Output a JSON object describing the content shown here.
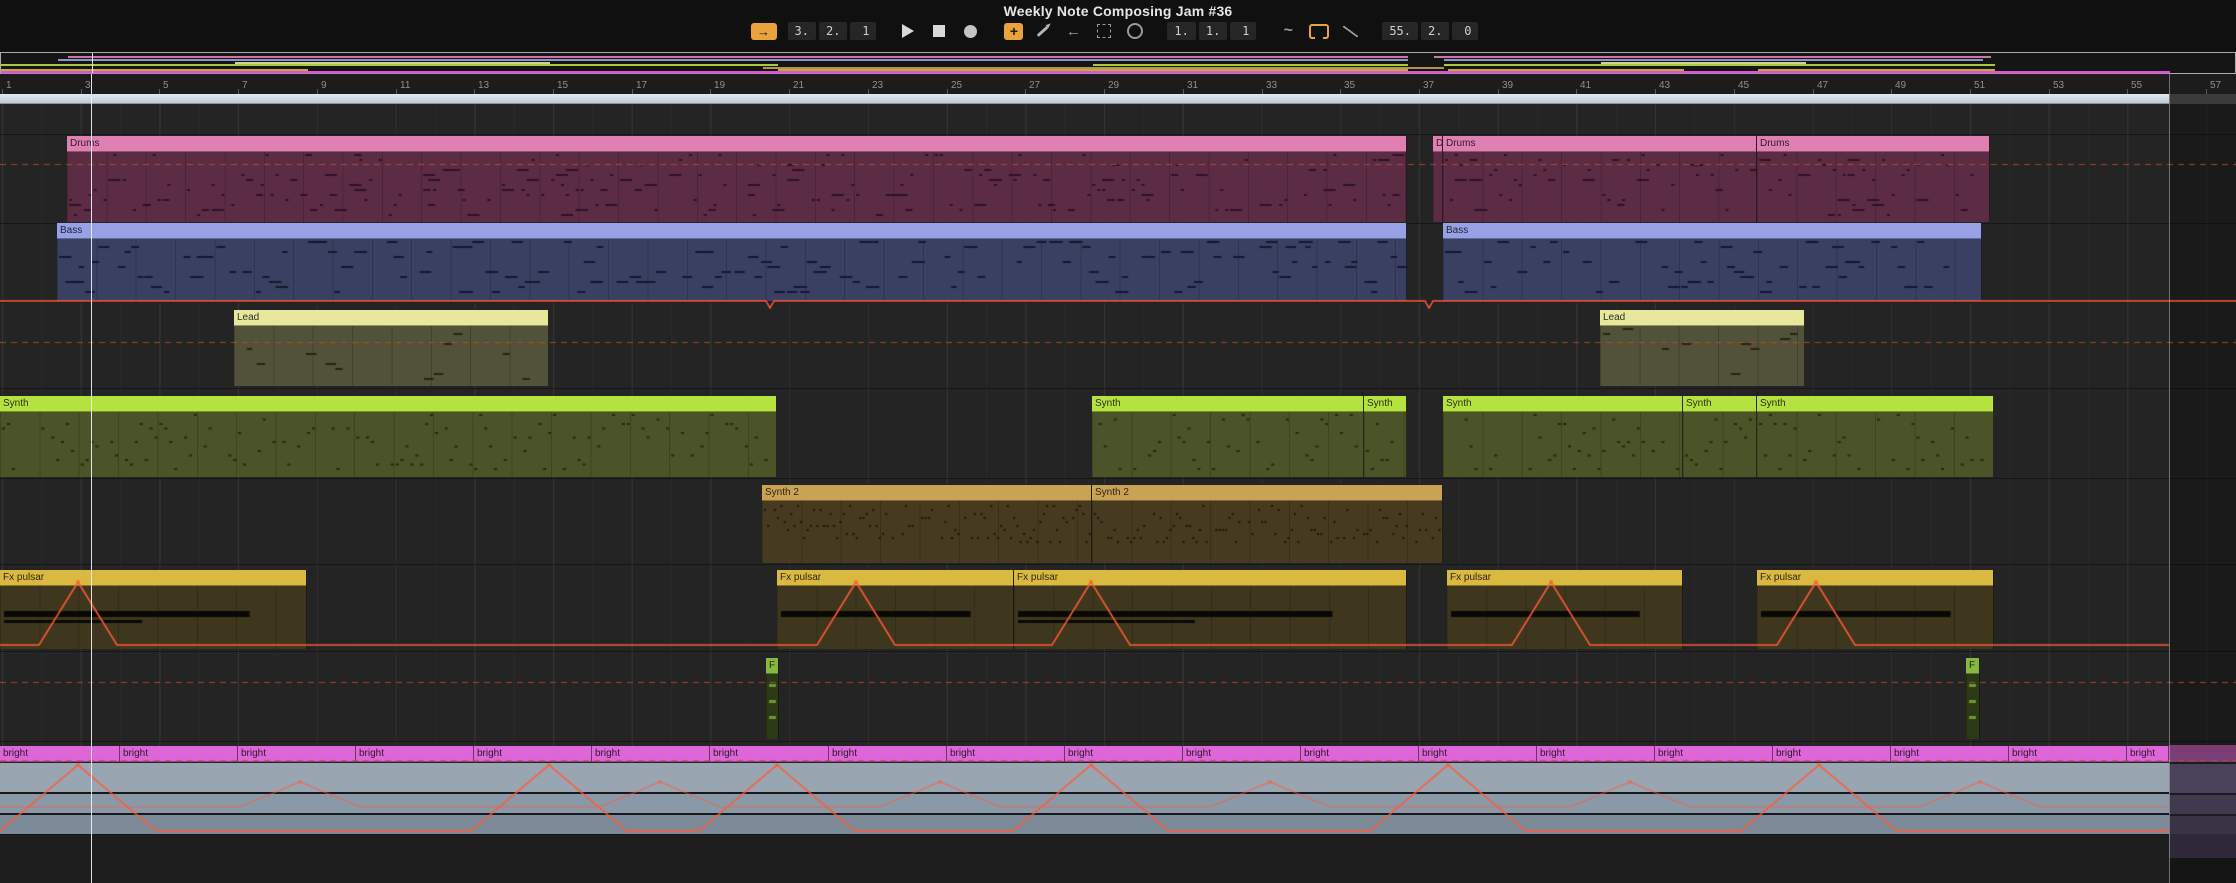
{
  "title": "Weekly Note Composing Jam #36",
  "transport": {
    "position": [
      "3.",
      "2.",
      "1"
    ],
    "loop_start": [
      "1.",
      "1.",
      "1"
    ],
    "loop_length": [
      "55.",
      "2.",
      "0"
    ]
  },
  "icons": {
    "follow": "→",
    "overdub_plus": "+",
    "back_arrow": "←",
    "wave": "~"
  },
  "ruler_numbers": [
    1,
    3,
    5,
    7,
    9,
    11,
    13,
    15,
    17,
    19,
    21,
    23,
    25,
    27,
    29,
    31,
    33,
    35,
    37,
    39,
    41,
    43,
    45,
    47,
    49,
    51,
    53,
    55,
    57
  ],
  "playhead_bar": 3.25,
  "arrangement_end_bar": 56.05,
  "colors": {
    "accent": "#e8a33d",
    "automation": "#ff5a36",
    "dashed_line": "#b5502c",
    "playhead": "#eef2f6",
    "loop_brace": "#cfd9e2"
  },
  "tracks": [
    {
      "name": "Drums",
      "header": "#df7fb2",
      "body": "#5c2c45",
      "note_color": "#2f1027",
      "clips": [
        {
          "label": "Drums",
          "start": 2.65,
          "end": 36.7
        },
        {
          "label": "D",
          "start": 37.35,
          "end": 37.6
        },
        {
          "label": "Drums",
          "start": 37.6,
          "end": 45.6
        },
        {
          "label": "Drums",
          "start": 45.6,
          "end": 51.5
        }
      ]
    },
    {
      "name": "Bass",
      "header": "#99a1e6",
      "body": "#3a4062",
      "note_color": "#141831",
      "clips": [
        {
          "label": "Bass",
          "start": 2.4,
          "end": 36.7
        },
        {
          "label": "Bass",
          "start": 37.6,
          "end": 51.3
        }
      ]
    },
    {
      "name": "Lead",
      "header": "#e7e79e",
      "body": "#515239",
      "note_color": "#26260f",
      "clips": [
        {
          "label": "Lead",
          "start": 6.9,
          "end": 14.9
        },
        {
          "label": "Lead",
          "start": 41.6,
          "end": 46.8
        }
      ]
    },
    {
      "name": "Synth",
      "header": "#b5e23e",
      "body": "#4a5428",
      "note_color": "#222b0a",
      "clips": [
        {
          "label": "Synth",
          "start": 0.95,
          "end": 20.7
        },
        {
          "label": "Synth",
          "start": 28.7,
          "end": 35.6
        },
        {
          "label": "Synth",
          "start": 35.6,
          "end": 36.7
        },
        {
          "label": "Synth",
          "start": 37.6,
          "end": 43.7
        },
        {
          "label": "Synth",
          "start": 43.7,
          "end": 45.6
        },
        {
          "label": "Synth",
          "start": 45.6,
          "end": 51.6
        }
      ]
    },
    {
      "name": "Synth 2",
      "header": "#c9a254",
      "body": "#463a20",
      "note_color": "#1f1606",
      "clips": [
        {
          "label": "Synth 2",
          "start": 20.3,
          "end": 28.7
        },
        {
          "label": "Synth 2",
          "start": 28.7,
          "end": 37.6
        }
      ]
    },
    {
      "name": "Fx pulsar",
      "header": "#d9b93f",
      "body": "#3e371e",
      "note_color": "#0a0805",
      "clips": [
        {
          "label": "Fx pulsar",
          "start": 0.95,
          "end": 8.75
        },
        {
          "label": "Fx pulsar",
          "start": 20.7,
          "end": 26.7
        },
        {
          "label": "Fx pulsar",
          "start": 26.7,
          "end": 36.7
        },
        {
          "label": "Fx pulsar",
          "start": 37.7,
          "end": 43.7
        },
        {
          "label": "Fx pulsar",
          "start": 45.6,
          "end": 51.6
        }
      ]
    },
    {
      "name": "F",
      "header": "#86b83e",
      "body": "#2c3916",
      "note_color": "#6f9a33",
      "clips": [
        {
          "label": "F",
          "start": 20.4,
          "end": 20.75
        },
        {
          "label": "F",
          "start": 50.9,
          "end": 51.25
        }
      ]
    },
    {
      "name": "bright",
      "header": "#de66d8",
      "body": "#8a99a8",
      "note_color": "#2b0d29",
      "clips": [
        {
          "label": "bright",
          "start": 0.95,
          "end": 4
        },
        {
          "label": "bright",
          "start": 4,
          "end": 7
        },
        {
          "label": "bright",
          "start": 7,
          "end": 10
        },
        {
          "label": "bright",
          "start": 10,
          "end": 13
        },
        {
          "label": "bright",
          "start": 13,
          "end": 16
        },
        {
          "label": "bright",
          "start": 16,
          "end": 19
        },
        {
          "label": "bright",
          "start": 19,
          "end": 22
        },
        {
          "label": "bright",
          "start": 22,
          "end": 25
        },
        {
          "label": "bright",
          "start": 25,
          "end": 28
        },
        {
          "label": "bright",
          "start": 28,
          "end": 31
        },
        {
          "label": "bright",
          "start": 31,
          "end": 34
        },
        {
          "label": "bright",
          "start": 34,
          "end": 37
        },
        {
          "label": "bright",
          "start": 37,
          "end": 40
        },
        {
          "label": "bright",
          "start": 40,
          "end": 43
        },
        {
          "label": "bright",
          "start": 43,
          "end": 46
        },
        {
          "label": "bright",
          "start": 46,
          "end": 49
        },
        {
          "label": "bright",
          "start": 49,
          "end": 52
        },
        {
          "label": "bright",
          "start": 52,
          "end": 55
        },
        {
          "label": "bright",
          "start": 55,
          "end": 56.05
        }
      ]
    }
  ]
}
